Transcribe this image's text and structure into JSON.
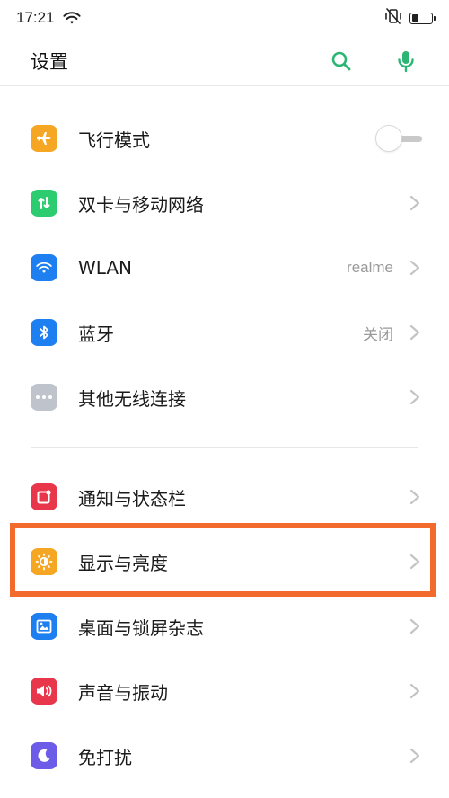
{
  "status_bar": {
    "time": "17:21",
    "wifi_icon": "wifi-icon",
    "mute_icon": "vibrate-off-icon",
    "battery_level": 0.35
  },
  "header": {
    "title": "设置",
    "search_icon": "search-icon",
    "mic_icon": "microphone-icon",
    "accent_color": "#2bb673"
  },
  "groups": [
    {
      "items": [
        {
          "label": "飞行模式",
          "icon": "airplane-icon",
          "color": "#f5a623",
          "value": "",
          "control": "toggle",
          "toggle_on": false
        },
        {
          "label": "双卡与移动网络",
          "icon": "sim-arrows-icon",
          "color": "#2ecc71",
          "value": "",
          "control": "chevron"
        },
        {
          "label": "WLAN",
          "icon": "wifi-icon",
          "color": "#1e7ff0",
          "value": "realme",
          "control": "chevron"
        },
        {
          "label": "蓝牙",
          "icon": "bluetooth-icon",
          "color": "#1e7ff0",
          "value": "关闭",
          "control": "chevron"
        },
        {
          "label": "其他无线连接",
          "icon": "more-dots-icon",
          "color": "#bfc3cc",
          "value": "",
          "control": "chevron"
        }
      ]
    },
    {
      "items": [
        {
          "label": "通知与状态栏",
          "icon": "notification-icon",
          "color": "#e8364a",
          "value": "",
          "control": "chevron"
        },
        {
          "label": "显示与亮度",
          "icon": "brightness-icon",
          "color": "#f5a623",
          "value": "",
          "control": "chevron"
        },
        {
          "label": "桌面与锁屏杂志",
          "icon": "wallpaper-icon",
          "color": "#1e7ff0",
          "value": "",
          "control": "chevron"
        },
        {
          "label": "声音与振动",
          "icon": "speaker-icon",
          "color": "#e8364a",
          "value": "",
          "control": "chevron"
        },
        {
          "label": "免打扰",
          "icon": "moon-icon",
          "color": "#6c5ce7",
          "value": "",
          "control": "chevron"
        }
      ]
    }
  ],
  "highlight_color": "#f26a2c"
}
